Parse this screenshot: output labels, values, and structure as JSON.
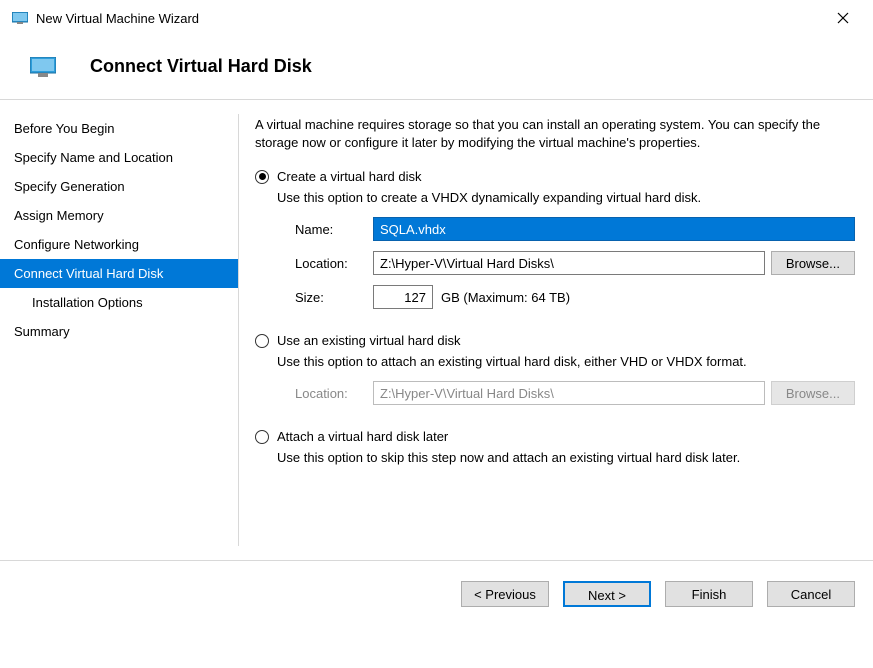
{
  "window": {
    "title": "New Virtual Machine Wizard"
  },
  "header": {
    "title": "Connect Virtual Hard Disk"
  },
  "sidebar": {
    "items": [
      {
        "label": "Before You Begin"
      },
      {
        "label": "Specify Name and Location"
      },
      {
        "label": "Specify Generation"
      },
      {
        "label": "Assign Memory"
      },
      {
        "label": "Configure Networking"
      },
      {
        "label": "Connect Virtual Hard Disk"
      },
      {
        "label": "Installation Options"
      },
      {
        "label": "Summary"
      }
    ]
  },
  "main": {
    "intro": "A virtual machine requires storage so that you can install an operating system. You can specify the storage now or configure it later by modifying the virtual machine's properties.",
    "opt_create": {
      "label": "Create a virtual hard disk",
      "desc": "Use this option to create a VHDX dynamically expanding virtual hard disk.",
      "name_label": "Name:",
      "name_value": "SQLA.vhdx",
      "location_label": "Location:",
      "location_value": "Z:\\Hyper-V\\Virtual Hard Disks\\",
      "browse_label": "Browse...",
      "size_label": "Size:",
      "size_value": "127",
      "size_suffix": "GB (Maximum: 64 TB)"
    },
    "opt_existing": {
      "label": "Use an existing virtual hard disk",
      "desc": "Use this option to attach an existing virtual hard disk, either VHD or VHDX format.",
      "location_label": "Location:",
      "location_value": "Z:\\Hyper-V\\Virtual Hard Disks\\",
      "browse_label": "Browse..."
    },
    "opt_later": {
      "label": "Attach a virtual hard disk later",
      "desc": "Use this option to skip this step now and attach an existing virtual hard disk later."
    }
  },
  "footer": {
    "previous": "< Previous",
    "next": "Next >",
    "finish": "Finish",
    "cancel": "Cancel"
  }
}
